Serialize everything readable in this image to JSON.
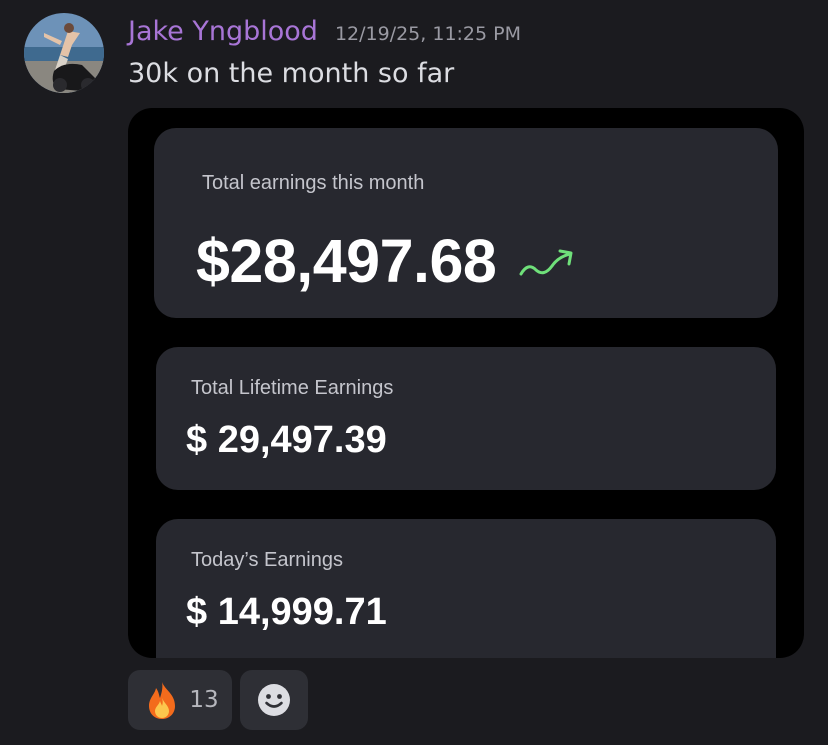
{
  "message": {
    "author": "Jake Yngblood",
    "timestamp": "12/19/25, 11:25 PM",
    "text": "30k on the month so far"
  },
  "attachment": {
    "cards": [
      {
        "label": "Total earnings this month",
        "value": "$28,497.68",
        "trend": "trending-up-icon",
        "trend_color": "#6fe07a"
      },
      {
        "label": "Total Lifetime Earnings",
        "value": "$ 29,497.39"
      },
      {
        "label": "Today’s Earnings",
        "value": "$ 14,999.71"
      }
    ]
  },
  "reactions": [
    {
      "emoji": "fire-icon",
      "count": "13"
    },
    {
      "emoji": "add-reaction-icon"
    }
  ],
  "colors": {
    "username": "#a875d6",
    "background": "#1b1b1f",
    "card": "#27282f"
  }
}
